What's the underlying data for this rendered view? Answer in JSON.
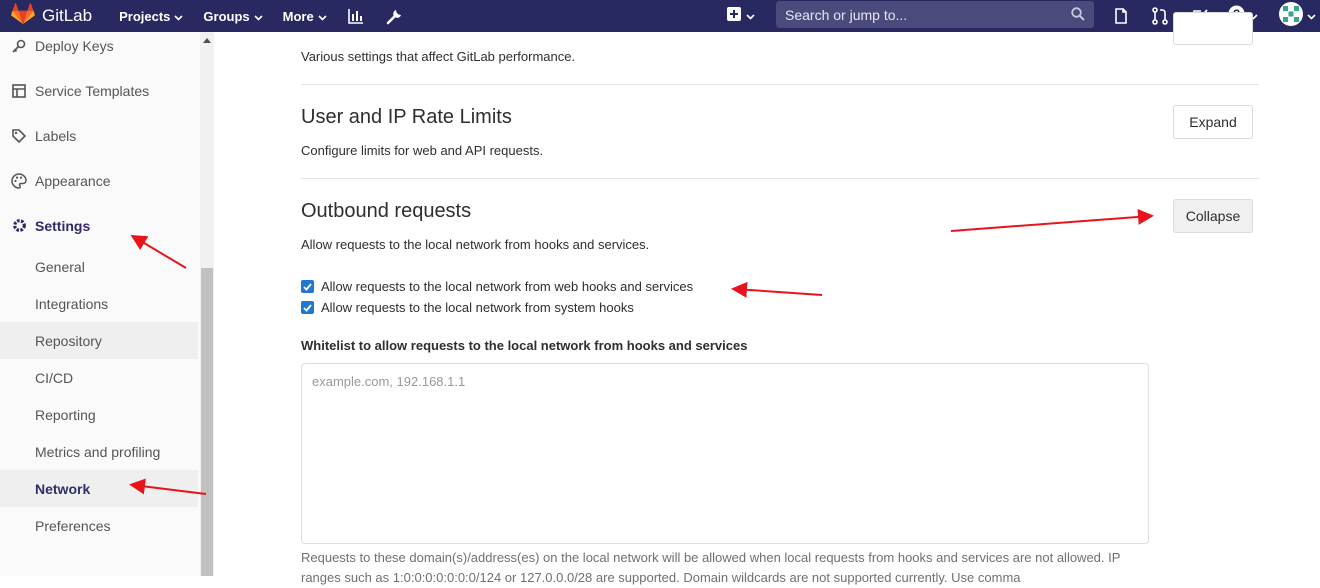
{
  "navbar": {
    "brand": "GitLab",
    "links": [
      {
        "label": "Projects",
        "icon": "chevron-down-icon"
      },
      {
        "label": "Groups",
        "icon": "chevron-down-icon"
      },
      {
        "label": "More",
        "icon": "chevron-down-icon"
      }
    ],
    "search_placeholder": "Search or jump to...",
    "bg_color": "#292961"
  },
  "sidebar": {
    "items": [
      {
        "label": "Deploy Keys",
        "icon": "key-icon"
      },
      {
        "label": "Service Templates",
        "icon": "template-icon"
      },
      {
        "label": "Labels",
        "icon": "label-icon"
      },
      {
        "label": "Appearance",
        "icon": "palette-icon"
      },
      {
        "label": "Settings",
        "icon": "gear-icon"
      }
    ],
    "sub_items": [
      {
        "label": "General"
      },
      {
        "label": "Integrations"
      },
      {
        "label": "Repository"
      },
      {
        "label": "CI/CD"
      },
      {
        "label": "Reporting"
      },
      {
        "label": "Metrics and profiling"
      },
      {
        "label": "Network"
      },
      {
        "label": "Preferences"
      }
    ],
    "active": "Network"
  },
  "main": {
    "performance": {
      "description": "Various settings that affect GitLab performance."
    },
    "rate_limits": {
      "title": "User and IP Rate Limits",
      "description": "Configure limits for web and API requests.",
      "button": "Expand"
    },
    "outbound": {
      "title": "Outbound requests",
      "description": "Allow requests to the local network from hooks and services.",
      "button": "Collapse",
      "checkboxes": [
        {
          "label": "Allow requests to the local network from web hooks and services",
          "checked": true
        },
        {
          "label": "Allow requests to the local network from system hooks",
          "checked": true
        }
      ],
      "whitelist_label": "Whitelist to allow requests to the local network from hooks and services",
      "whitelist_placeholder": "example.com, 192.168.1.1",
      "help_text": "Requests to these domain(s)/address(es) on the local network will be allowed when local requests from hooks and services are not allowed. IP ranges such as 1:0:0:0:0:0:0:0/124 or 127.0.0.0/28 are supported. Domain wildcards are not supported currently. Use comma"
    }
  },
  "annotation_color": "#e8141b"
}
